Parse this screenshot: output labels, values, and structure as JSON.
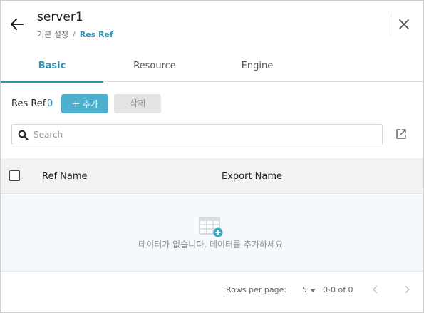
{
  "header": {
    "title": "server1",
    "breadcrumb": [
      "기본 설정",
      "Res Ref"
    ],
    "breadcrumb_separator": "/"
  },
  "tabs": [
    {
      "label": "Basic",
      "active": true
    },
    {
      "label": "Resource",
      "active": false
    },
    {
      "label": "Engine",
      "active": false
    }
  ],
  "toolbar": {
    "section_label": "Res Ref",
    "count": "0",
    "add_label": "추가",
    "delete_label": "삭제"
  },
  "search": {
    "placeholder": "Search",
    "value": ""
  },
  "table": {
    "columns": [
      "Ref Name",
      "Export Name"
    ],
    "rows": [],
    "empty_message": "데이터가 없습니다. 데이터를 추가하세요."
  },
  "pagination": {
    "rows_per_page_label": "Rows per page:",
    "rows_per_page": "5",
    "range": "0-0 of 0"
  },
  "colors": {
    "accent": "#2d93b4",
    "add_button": "#4db0cf",
    "empty_bg": "#f5f8fc",
    "header_bg": "#f2f2f2"
  },
  "icons": [
    "arrow-left-icon",
    "close-icon",
    "plus-icon",
    "search-icon",
    "open-in-new-icon",
    "table-add-icon",
    "chevron-left-icon",
    "chevron-right-icon",
    "caret-down-icon"
  ]
}
